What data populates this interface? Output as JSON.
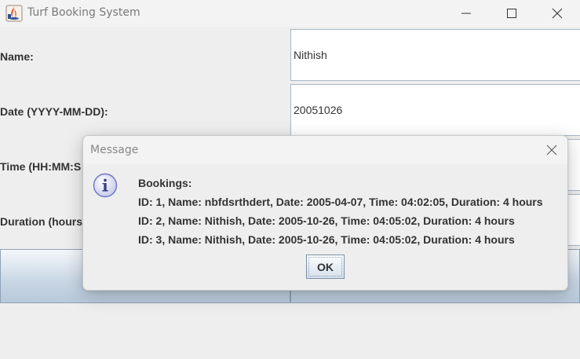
{
  "window": {
    "title": "Turf Booking System",
    "icon": "java-app-icon",
    "controls": [
      "minimize-icon",
      "maximize-icon",
      "close-icon"
    ]
  },
  "form": {
    "name_label": "Name:",
    "name_value": "Nithish",
    "date_label": "Date (YYYY-MM-DD):",
    "date_value": "20051026",
    "time_label": "Time (HH:MM:S",
    "duration_label": "Duration (hours"
  },
  "dialog": {
    "title": "Message",
    "icon": "info-icon",
    "lines": [
      "Bookings:",
      "ID: 1, Name: nbfdsrthdert, Date: 2005-04-07, Time: 04:02:05, Duration: 4 hours",
      "ID: 2, Name: Nithish, Date: 2005-10-26, Time: 04:05:02, Duration: 4 hours",
      "ID: 3, Name: Nithish, Date: 2005-10-26, Time: 04:05:02, Duration: 4 hours"
    ],
    "ok_label": "OK"
  },
  "colors": {
    "background": "#eeeeee",
    "field_border": "#a9b8c8",
    "button_gradient_top": "#f4f7fa",
    "button_gradient_bottom": "#b8c9da",
    "info_icon": "#8a8fd6"
  }
}
